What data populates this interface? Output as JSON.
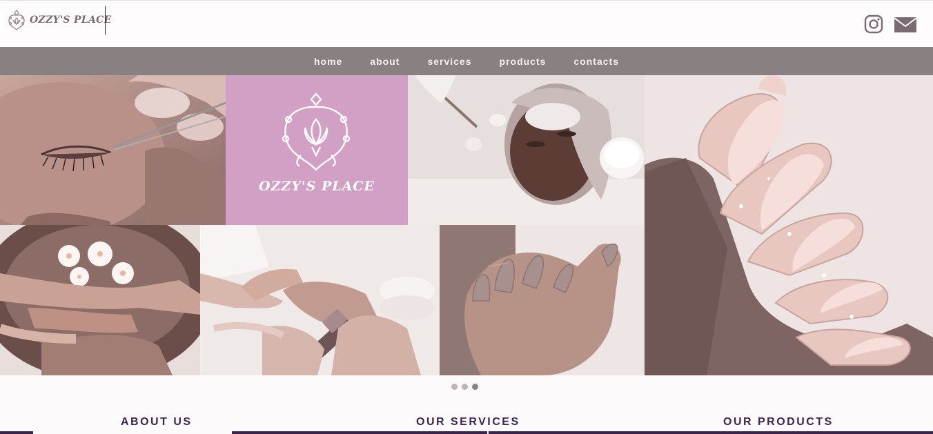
{
  "brand": {
    "name": "OZZY'S PLACE",
    "hero_name": "OZZY'S PLACE"
  },
  "nav": {
    "items": [
      "home",
      "about",
      "services",
      "products",
      "contacts"
    ]
  },
  "social": {
    "icons": [
      "instagram-icon",
      "mail-icon"
    ]
  },
  "hero": {
    "tiles": [
      "eyelash-extension-photo",
      "brand-logo-tile",
      "facial-treatment-photo",
      "almond-nails-photo",
      "pedicure-bowl-photo",
      "manicure-photo",
      "nude-nails-photo"
    ],
    "slide_count": 3,
    "active_slide": 3
  },
  "sections": {
    "about": "ABOUT US",
    "services": "OUR SERVICES",
    "products": "OUR PRODUCTS"
  },
  "colors": {
    "accent": "#3d2450",
    "nav_bg": "#888081",
    "brand_tile": "#d3a0c5",
    "logo_text": "#7b6a74"
  }
}
